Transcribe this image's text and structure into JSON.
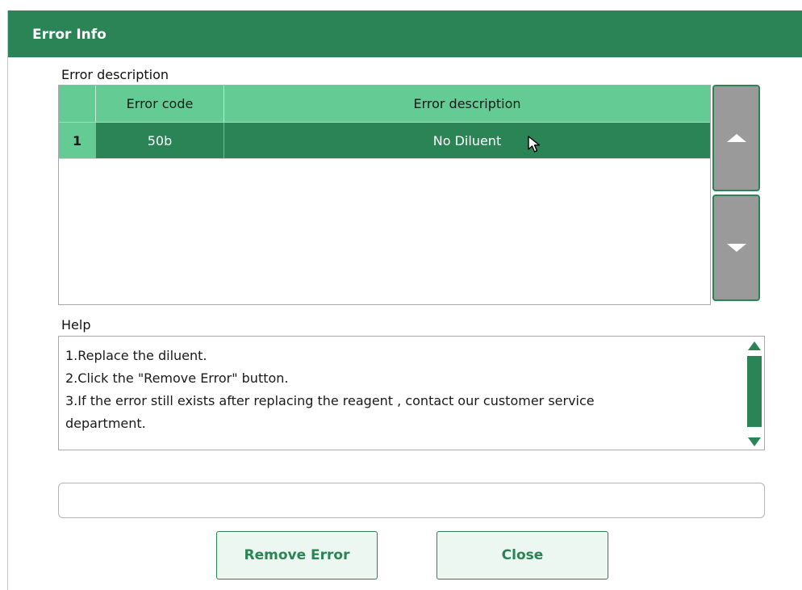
{
  "window": {
    "title": "Error Info"
  },
  "error_section": {
    "label": "Error description",
    "columns": [
      "",
      "Error code",
      "Error description"
    ],
    "rows": [
      {
        "index": "1",
        "code": "50b",
        "description": "No Diluent"
      }
    ]
  },
  "help_section": {
    "label": "Help",
    "lines": [
      "1.Replace the diluent.",
      "2.Click the \"Remove Error\" button.",
      "3.If the error still exists after replacing the reagent , contact our customer service",
      "department."
    ]
  },
  "status_field": {
    "value": ""
  },
  "buttons": {
    "remove_error": "Remove Error",
    "close": "Close"
  },
  "colors": {
    "accent": "#2a8456",
    "header_green": "#63cb93",
    "scroll_gray": "#9a9a9a"
  }
}
